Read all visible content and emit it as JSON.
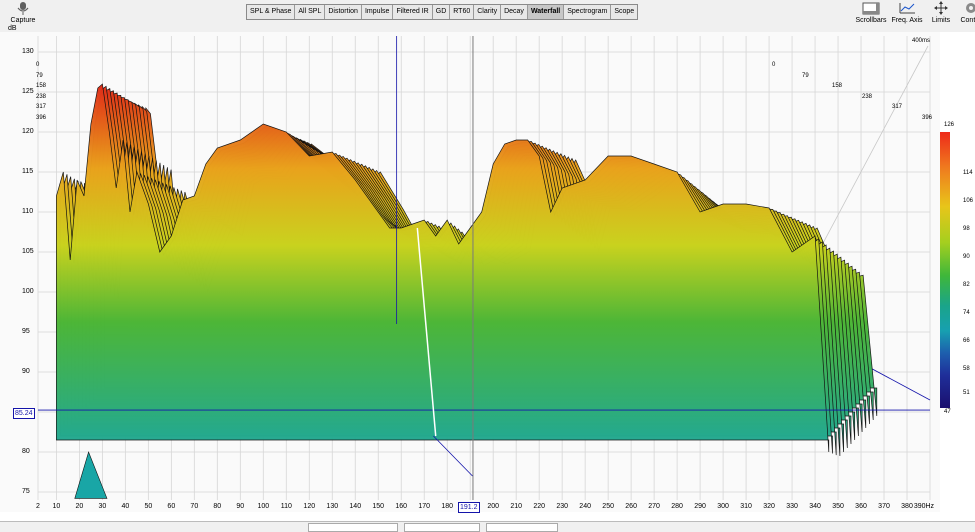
{
  "app": {
    "toolbar_left": [
      {
        "label": "Capture",
        "icon": "microphone-icon"
      }
    ],
    "toolbar_right": [
      {
        "label": "Scrollbars",
        "icon": "scrollbars-icon"
      },
      {
        "label": "Freq. Axis",
        "icon": "freq-axis-icon"
      },
      {
        "label": "Limits",
        "icon": "limits-icon"
      },
      {
        "label": "Contro",
        "icon": "gear-icon"
      }
    ],
    "tabs": [
      {
        "label": "SPL & Phase",
        "active": false
      },
      {
        "label": "All SPL",
        "active": false
      },
      {
        "label": "Distortion",
        "active": false
      },
      {
        "label": "Impulse",
        "active": false
      },
      {
        "label": "Filtered IR",
        "active": false
      },
      {
        "label": "GD",
        "active": false
      },
      {
        "label": "RT60",
        "active": false
      },
      {
        "label": "Clarity",
        "active": false
      },
      {
        "label": "Decay",
        "active": false
      },
      {
        "label": "Waterfall",
        "active": true
      },
      {
        "label": "Spectrogram",
        "active": false
      },
      {
        "label": "Scope",
        "active": false
      }
    ],
    "colors": {
      "background": "#fafafa",
      "grid": "#d6d6d6",
      "cursor": "#1414aa",
      "hot": "#e8321c",
      "mid": "#5ab734",
      "cool": "#1aa4a0"
    }
  },
  "chart_data": {
    "type": "waterfall",
    "unit_label": "dB",
    "y_ticks": [
      "130",
      "125",
      "120",
      "115",
      "110",
      "105",
      "100",
      "95",
      "90",
      "85",
      "80",
      "75"
    ],
    "y_range": [
      74,
      132
    ],
    "x_unit": "Hz",
    "x_ticks": [
      "2",
      "10",
      "20",
      "30",
      "40",
      "50",
      "60",
      "70",
      "80",
      "90",
      "100",
      "110",
      "120",
      "130",
      "140",
      "150",
      "160",
      "170",
      "180",
      "190",
      "200",
      "210",
      "220",
      "230",
      "240",
      "250",
      "260",
      "270",
      "280",
      "290",
      "300",
      "310",
      "320",
      "330",
      "340",
      "350",
      "360",
      "370",
      "380",
      "390Hz"
    ],
    "x_range": [
      2,
      390
    ],
    "time_slices_left": [
      "0",
      "79",
      "158",
      "238",
      "317",
      "396"
    ],
    "time_slices_right": [
      "0",
      "79",
      "158",
      "238",
      "317",
      "396"
    ],
    "time_max": "400ms",
    "crosshair": {
      "x_hz": 191.2,
      "y_db": 85.24,
      "x_label": "191.2",
      "y_label": "85.24"
    },
    "colorbar": {
      "ticks": [
        "126",
        "114",
        "106",
        "98",
        "90",
        "82",
        "74",
        "66",
        "58",
        "51",
        "47"
      ],
      "min": 47,
      "max": 126
    },
    "front_slice": {
      "freqs": [
        10,
        13,
        16,
        19,
        22,
        25,
        28,
        30,
        33,
        36,
        39,
        42,
        45,
        50,
        55,
        60,
        65,
        70,
        75,
        80,
        90,
        100,
        110,
        120,
        130,
        140,
        150,
        155,
        160,
        165,
        170,
        175,
        180,
        185,
        190,
        195,
        200,
        205,
        210,
        215,
        220,
        225,
        230,
        240,
        250,
        260,
        270,
        280,
        290,
        300,
        310,
        320,
        330,
        340,
        346
      ],
      "db": [
        112,
        115,
        104,
        114,
        112,
        121,
        125.5,
        126,
        120,
        113,
        119,
        110,
        115,
        111,
        105,
        107,
        111.5,
        112,
        116,
        118,
        119,
        121,
        120,
        117,
        117.5,
        114,
        110,
        108,
        108,
        108.5,
        109,
        107,
        109,
        106,
        108,
        110,
        116,
        118.5,
        119,
        119,
        117,
        110,
        113,
        114,
        117,
        117,
        116,
        115,
        110,
        111,
        111,
        110.5,
        105,
        107,
        80
      ]
    }
  }
}
